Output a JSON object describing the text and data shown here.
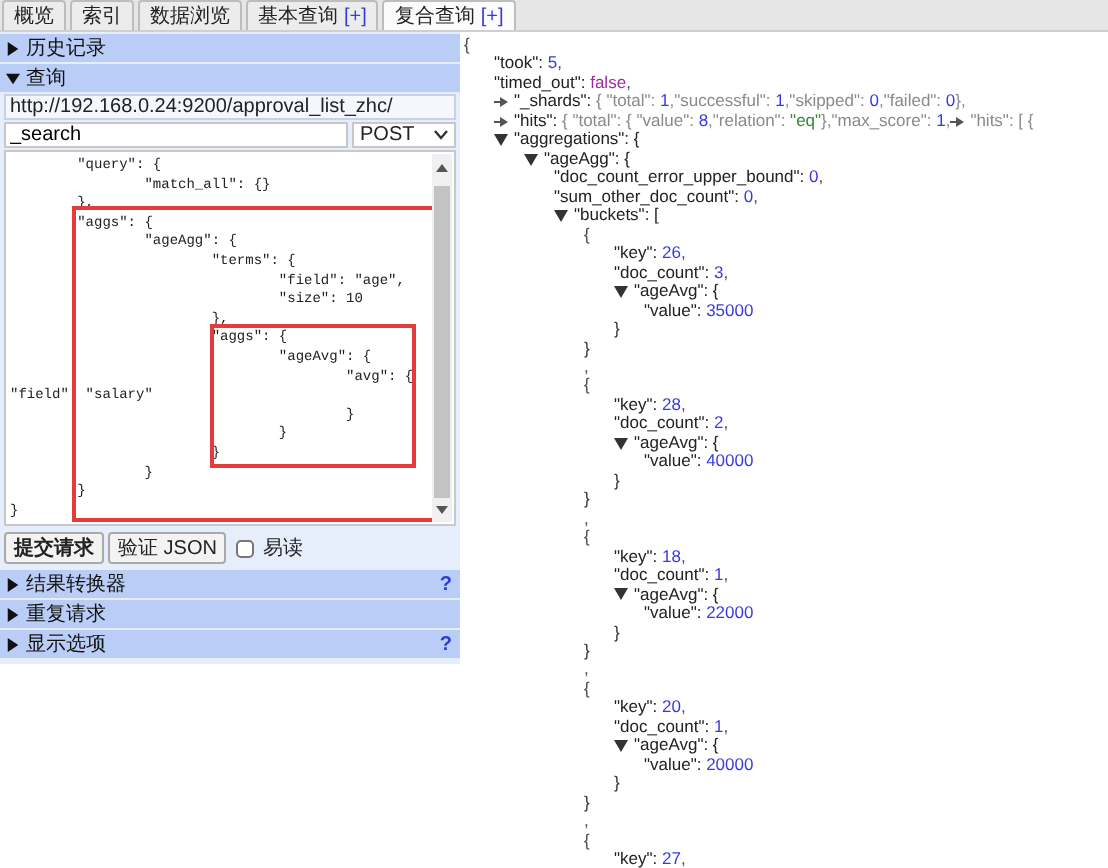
{
  "tabs": [
    {
      "label": "概览",
      "selected": false
    },
    {
      "label": "索引",
      "selected": false
    },
    {
      "label": "数据浏览",
      "selected": false
    },
    {
      "label": "基本查询",
      "plus": "[+]",
      "selected": false
    },
    {
      "label": "复合查询",
      "plus": "[+]",
      "selected": true
    }
  ],
  "history": {
    "label": "历史记录",
    "expanded": false
  },
  "query": {
    "label": "查询",
    "expanded": true,
    "url": "http://192.168.0.24:9200/approval_list_zhc/",
    "path": "_search",
    "method": "POST",
    "body_lines": [
      "        \"query\": {",
      "                \"match_all\": {}",
      "        },",
      "        \"aggs\": {",
      "                \"ageAgg\": {",
      "                        \"terms\": {",
      "                                \"field\": \"age\",",
      "                                \"size\": 10",
      "                        },",
      "                        \"aggs\": {",
      "                                \"ageAvg\": {",
      "                                        \"avg\": {",
      "\"field\"  \"salary\"",
      "                                        }",
      "                                }",
      "                        }",
      "                }",
      "        }",
      "}"
    ],
    "buttons": [
      {
        "label": "提交请求",
        "kind": "primary"
      },
      {
        "label": "验证 JSON",
        "kind": "secondary"
      }
    ],
    "checkbox": {
      "label": "易读",
      "checked": false
    }
  },
  "panels": [
    {
      "label": "结果转换器",
      "expanded": false,
      "help": "?"
    },
    {
      "label": "重复请求",
      "expanded": false
    },
    {
      "label": "显示选项",
      "expanded": false,
      "help": "?"
    }
  ],
  "result": {
    "kind": "block",
    "parts": [
      {
        "text": "{",
        "kind": "punct"
      }
    ],
    "children": [
      {
        "kind": "pair",
        "parts": [
          {
            "text": "\"took\": ",
            "kind": "key"
          },
          {
            "text": "5",
            "kind": "number"
          },
          {
            "text": ",",
            "kind": "punct"
          }
        ]
      },
      {
        "kind": "pair",
        "parts": [
          {
            "text": "\"timed_out\": ",
            "kind": "key"
          },
          {
            "text": "false",
            "kind": "bool"
          },
          {
            "text": ",",
            "kind": "punct"
          }
        ]
      },
      {
        "kind": "branch",
        "expanded": false,
        "parts": [
          {
            "text": "\"_shards\": ",
            "kind": "key"
          },
          {
            "text": "{ \"total\": ",
            "kind": "dim"
          },
          {
            "text": "1",
            "kind": "number"
          },
          {
            "text": ",\"successful\": ",
            "kind": "dim"
          },
          {
            "text": "1",
            "kind": "number"
          },
          {
            "text": ",\"skipped\": ",
            "kind": "dim"
          },
          {
            "text": "0",
            "kind": "number"
          },
          {
            "text": ",\"failed\": ",
            "kind": "dim"
          },
          {
            "text": "0",
            "kind": "number"
          },
          {
            "text": "},",
            "kind": "dim"
          }
        ]
      },
      {
        "kind": "branch",
        "expanded": false,
        "parts": [
          {
            "text": "\"hits\": ",
            "kind": "key"
          },
          {
            "text": "{ \"total\": { \"value\": ",
            "kind": "dim"
          },
          {
            "text": "8",
            "kind": "number"
          },
          {
            "text": ",\"relation\": ",
            "kind": "dim"
          },
          {
            "text": "\"eq\"",
            "kind": "string"
          },
          {
            "text": "},\"max_score\": ",
            "kind": "dim"
          },
          {
            "text": "1",
            "kind": "number"
          },
          {
            "text": ",",
            "kind": "dim"
          },
          {
            "kind": "toggle",
            "expanded": false
          },
          {
            "text": "\"hits\": [ {",
            "kind": "dim"
          }
        ]
      },
      {
        "kind": "branch",
        "expanded": true,
        "parts": [
          {
            "text": "\"aggregations\": {",
            "kind": "key"
          }
        ],
        "children": [
          {
            "kind": "branch",
            "expanded": true,
            "parts": [
              {
                "text": "\"ageAgg\": {",
                "kind": "key"
              }
            ],
            "children": [
              {
                "kind": "pair",
                "parts": [
                  {
                    "text": "\"doc_count_error_upper_bound\": ",
                    "kind": "key"
                  },
                  {
                    "text": "0",
                    "kind": "number"
                  },
                  {
                    "text": ",",
                    "kind": "punct"
                  }
                ]
              },
              {
                "kind": "pair",
                "parts": [
                  {
                    "text": "\"sum_other_doc_count\": ",
                    "kind": "key"
                  },
                  {
                    "text": "0",
                    "kind": "number"
                  },
                  {
                    "text": ",",
                    "kind": "punct"
                  }
                ]
              },
              {
                "kind": "branch",
                "expanded": true,
                "parts": [
                  {
                    "text": "\"buckets\": [",
                    "kind": "key"
                  }
                ],
                "children": [
                  {
                    "kind": "block",
                    "parts": [
                      {
                        "text": "{",
                        "kind": "punct"
                      }
                    ],
                    "close": "}",
                    "children": [
                      {
                        "kind": "pair",
                        "parts": [
                          {
                            "text": "\"key\": ",
                            "kind": "key"
                          },
                          {
                            "text": "26",
                            "kind": "number"
                          },
                          {
                            "text": ",",
                            "kind": "punct"
                          }
                        ]
                      },
                      {
                        "kind": "pair",
                        "parts": [
                          {
                            "text": "\"doc_count\": ",
                            "kind": "key"
                          },
                          {
                            "text": "3",
                            "kind": "number"
                          },
                          {
                            "text": ",",
                            "kind": "punct"
                          }
                        ]
                      },
                      {
                        "kind": "branch",
                        "expanded": true,
                        "parts": [
                          {
                            "text": "\"ageAvg\": {",
                            "kind": "key"
                          }
                        ],
                        "close": "}",
                        "children": [
                          {
                            "kind": "pair",
                            "parts": [
                              {
                                "text": "\"value\": ",
                                "kind": "key"
                              },
                              {
                                "text": "35000",
                                "kind": "number"
                              }
                            ]
                          }
                        ]
                      }
                    ]
                  },
                  {
                    "kind": "pair",
                    "parts": [
                      {
                        "text": ",",
                        "kind": "punct"
                      }
                    ]
                  },
                  {
                    "kind": "block",
                    "parts": [
                      {
                        "text": "{",
                        "kind": "punct"
                      }
                    ],
                    "close": "}",
                    "children": [
                      {
                        "kind": "pair",
                        "parts": [
                          {
                            "text": "\"key\": ",
                            "kind": "key"
                          },
                          {
                            "text": "28",
                            "kind": "number"
                          },
                          {
                            "text": ",",
                            "kind": "punct"
                          }
                        ]
                      },
                      {
                        "kind": "pair",
                        "parts": [
                          {
                            "text": "\"doc_count\": ",
                            "kind": "key"
                          },
                          {
                            "text": "2",
                            "kind": "number"
                          },
                          {
                            "text": ",",
                            "kind": "punct"
                          }
                        ]
                      },
                      {
                        "kind": "branch",
                        "expanded": true,
                        "parts": [
                          {
                            "text": "\"ageAvg\": {",
                            "kind": "key"
                          }
                        ],
                        "close": "}",
                        "children": [
                          {
                            "kind": "pair",
                            "parts": [
                              {
                                "text": "\"value\": ",
                                "kind": "key"
                              },
                              {
                                "text": "40000",
                                "kind": "number"
                              }
                            ]
                          }
                        ]
                      }
                    ]
                  },
                  {
                    "kind": "pair",
                    "parts": [
                      {
                        "text": ",",
                        "kind": "punct"
                      }
                    ]
                  },
                  {
                    "kind": "block",
                    "parts": [
                      {
                        "text": "{",
                        "kind": "punct"
                      }
                    ],
                    "close": "}",
                    "children": [
                      {
                        "kind": "pair",
                        "parts": [
                          {
                            "text": "\"key\": ",
                            "kind": "key"
                          },
                          {
                            "text": "18",
                            "kind": "number"
                          },
                          {
                            "text": ",",
                            "kind": "punct"
                          }
                        ]
                      },
                      {
                        "kind": "pair",
                        "parts": [
                          {
                            "text": "\"doc_count\": ",
                            "kind": "key"
                          },
                          {
                            "text": "1",
                            "kind": "number"
                          },
                          {
                            "text": ",",
                            "kind": "punct"
                          }
                        ]
                      },
                      {
                        "kind": "branch",
                        "expanded": true,
                        "parts": [
                          {
                            "text": "\"ageAvg\": {",
                            "kind": "key"
                          }
                        ],
                        "close": "}",
                        "children": [
                          {
                            "kind": "pair",
                            "parts": [
                              {
                                "text": "\"value\": ",
                                "kind": "key"
                              },
                              {
                                "text": "22000",
                                "kind": "number"
                              }
                            ]
                          }
                        ]
                      }
                    ]
                  },
                  {
                    "kind": "pair",
                    "parts": [
                      {
                        "text": ",",
                        "kind": "punct"
                      }
                    ]
                  },
                  {
                    "kind": "block",
                    "parts": [
                      {
                        "text": "{",
                        "kind": "punct"
                      }
                    ],
                    "close": "}",
                    "children": [
                      {
                        "kind": "pair",
                        "parts": [
                          {
                            "text": "\"key\": ",
                            "kind": "key"
                          },
                          {
                            "text": "20",
                            "kind": "number"
                          },
                          {
                            "text": ",",
                            "kind": "punct"
                          }
                        ]
                      },
                      {
                        "kind": "pair",
                        "parts": [
                          {
                            "text": "\"doc_count\": ",
                            "kind": "key"
                          },
                          {
                            "text": "1",
                            "kind": "number"
                          },
                          {
                            "text": ",",
                            "kind": "punct"
                          }
                        ]
                      },
                      {
                        "kind": "branch",
                        "expanded": true,
                        "parts": [
                          {
                            "text": "\"ageAvg\": {",
                            "kind": "key"
                          }
                        ],
                        "close": "}",
                        "children": [
                          {
                            "kind": "pair",
                            "parts": [
                              {
                                "text": "\"value\": ",
                                "kind": "key"
                              },
                              {
                                "text": "20000",
                                "kind": "number"
                              }
                            ]
                          }
                        ]
                      }
                    ]
                  },
                  {
                    "kind": "pair",
                    "parts": [
                      {
                        "text": ",",
                        "kind": "punct"
                      }
                    ]
                  },
                  {
                    "kind": "block",
                    "parts": [
                      {
                        "text": "{",
                        "kind": "punct"
                      }
                    ],
                    "children": [
                      {
                        "kind": "pair",
                        "parts": [
                          {
                            "text": "\"key\": ",
                            "kind": "key"
                          },
                          {
                            "text": "27",
                            "kind": "number"
                          },
                          {
                            "text": ",",
                            "kind": "punct"
                          }
                        ]
                      }
                    ]
                  }
                ]
              }
            ]
          }
        ]
      }
    ]
  }
}
